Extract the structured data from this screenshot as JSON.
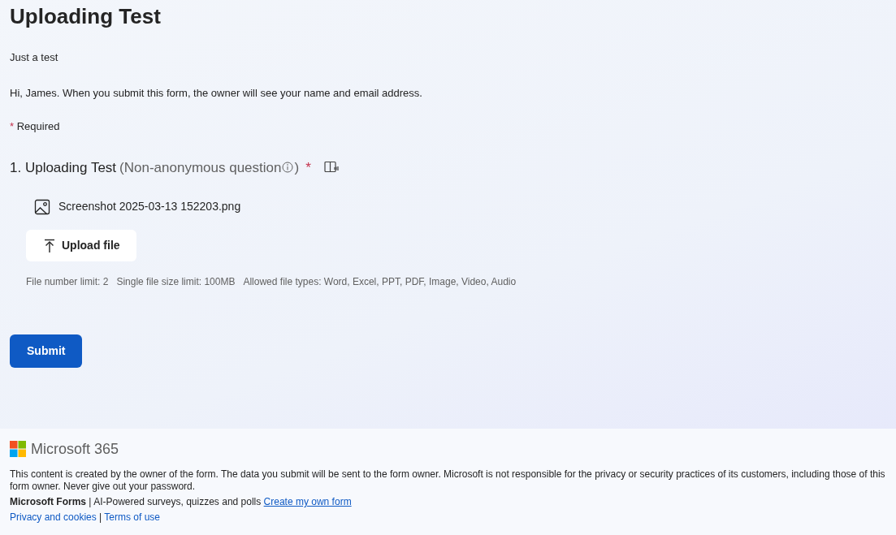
{
  "form": {
    "title": "Uploading Test",
    "description": "Just a test",
    "notice": "Hi, James. When you submit this form, the owner will see your name and email address.",
    "required_mark": "*",
    "required_label": "Required"
  },
  "question": {
    "number": "1.",
    "title": "Uploading Test",
    "qualifier_open": "(Non-anonymous question",
    "qualifier_close": ")",
    "required": true,
    "files": [
      {
        "name": "Screenshot 2025-03-13 152203.png"
      }
    ],
    "upload_button": "Upload file",
    "limits": [
      "File number limit: 2",
      "Single file size limit: 100MB",
      "Allowed file types: Word, Excel, PPT, PDF, Image, Video, Audio"
    ]
  },
  "submit_button": "Submit",
  "footer": {
    "brand": "Microsoft 365",
    "disclaimer": "This content is created by the owner of the form. The data you submit will be sent to the form owner. Microsoft is not responsible for the privacy or security practices of its customers, including those of this form owner. Never give out your password.",
    "product": "**Microsoft Forms** | AI-Powered surveys, quizzes and polls",
    "create_link": "Create my own form",
    "links": [
      "Privacy and cookies",
      "Terms of use"
    ],
    "link_separator": "|"
  }
}
